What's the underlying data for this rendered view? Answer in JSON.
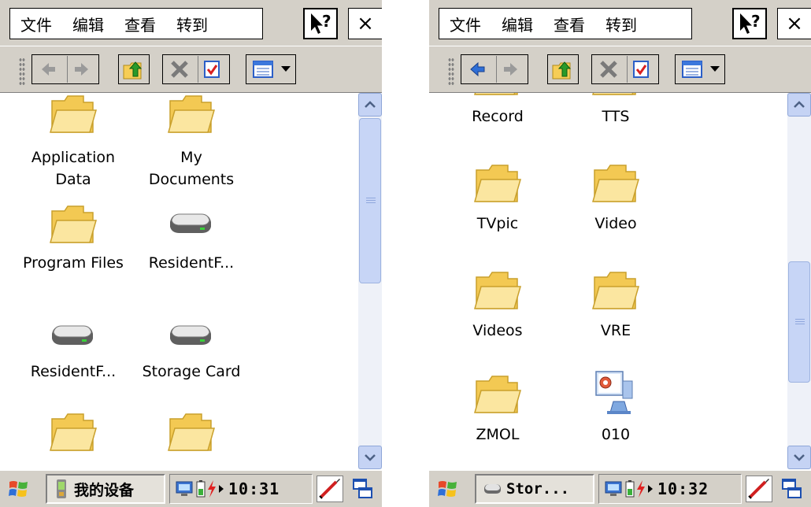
{
  "panels": [
    {
      "menu": {
        "items": [
          "文件",
          "编辑",
          "查看",
          "转到"
        ]
      },
      "close_glyph": "×",
      "icons": [
        {
          "label": "Application\nData",
          "type": "folder"
        },
        {
          "label": "My\nDocuments",
          "type": "folder"
        },
        {
          "label": "Program Files",
          "type": "folder"
        },
        {
          "label": "ResidentF...",
          "type": "drive"
        },
        {
          "label": "ResidentF...",
          "type": "drive"
        },
        {
          "label": "Storage Card",
          "type": "drive"
        },
        {
          "label": "",
          "type": "folder"
        },
        {
          "label": "",
          "type": "folder"
        }
      ],
      "taskbar": {
        "task_label": "我的设备",
        "clock": "10:31"
      }
    },
    {
      "menu": {
        "items": [
          "文件",
          "编辑",
          "查看",
          "转到"
        ]
      },
      "close_glyph": "×",
      "icons": [
        {
          "label": "Record",
          "type": "folder-partial"
        },
        {
          "label": "TTS",
          "type": "folder-partial"
        },
        {
          "label": "TVpic",
          "type": "folder"
        },
        {
          "label": "Video",
          "type": "folder"
        },
        {
          "label": "Videos",
          "type": "folder"
        },
        {
          "label": "VRE",
          "type": "folder"
        },
        {
          "label": "ZMOL",
          "type": "folder"
        },
        {
          "label": "010",
          "type": "program"
        }
      ],
      "taskbar": {
        "task_label": "Stor...",
        "clock": "10:32"
      }
    }
  ],
  "colors": {
    "chrome": "#d4d0c8",
    "folder": "#f8dc7c",
    "scrollbar": "#c7d5f6"
  }
}
